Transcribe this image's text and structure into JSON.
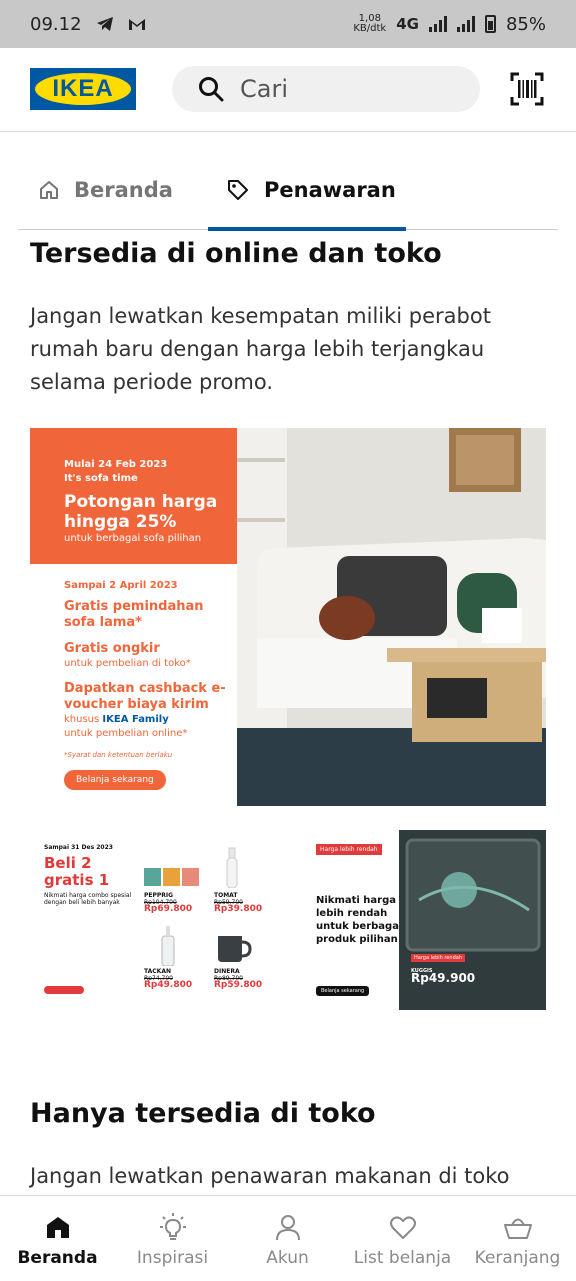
{
  "status_bar": {
    "time": "09.12",
    "net_speed_value": "1,08",
    "net_speed_unit": "KB/dtk",
    "network": "4G",
    "battery": "85%"
  },
  "header": {
    "logo_text": "IKEA",
    "search_placeholder": "Cari"
  },
  "tabs": [
    {
      "label": "Beranda"
    },
    {
      "label": "Penawaran"
    }
  ],
  "section1": {
    "title": "Tersedia di online dan toko",
    "description": "Jangan lewatkan kesempatan miliki perabot rumah baru dengan harga lebih terjangkau selama periode promo."
  },
  "promo": {
    "start": "Mulai 24 Feb 2023",
    "tagline": "It's sofa time",
    "headline": "Potongan harga hingga 25%",
    "subline": "untuk berbagai sofa pilihan",
    "until": "Sampai 2 April 2023",
    "offer1": "Gratis pemindahan sofa lama*",
    "offer2_title": "Gratis ongkir",
    "offer2_sub": "untuk pembelian di toko*",
    "offer3_title": "Dapatkan cashback e-voucher biaya kirim",
    "offer3_pre": "khusus",
    "offer3_brand": "IKEA Family",
    "offer3_post": "untuk pembelian online*",
    "terms": "*Syarat dan ketentuan berlaku",
    "button": "Belanja sekarang"
  },
  "cards": {
    "card1": {
      "date": "Sampai 31 Des 2023",
      "title": "Beli 2 gratis 1",
      "note": "Nikmati harga combo spesial dengan beli lebih banyak"
    },
    "products": [
      {
        "name": "PEPPRIG",
        "old": "Rp104.700",
        "price": "Rp69.800"
      },
      {
        "name": "TOMAT",
        "old": "Rp59.700",
        "price": "Rp39.800"
      },
      {
        "name": "TACKAN",
        "old": "Rp74.700",
        "price": "Rp49.800"
      },
      {
        "name": "DINERA",
        "old": "Rp89.700",
        "price": "Rp59.800"
      }
    ],
    "card3": {
      "tag": "Harga lebih rendah",
      "text": "Nikmati harga lebih rendah untuk berbagai produk pilihan",
      "button": "Belanja sekarang"
    },
    "card4": {
      "badge": "Harga lebih rendah",
      "name": "KUGGIS",
      "price": "Rp49.900"
    }
  },
  "section2": {
    "title": "Hanya tersedia di toko",
    "description": "Jangan lewatkan penawaran makanan di toko IKEA."
  },
  "bottom_nav": [
    {
      "label": "Beranda"
    },
    {
      "label": "Inspirasi"
    },
    {
      "label": "Akun"
    },
    {
      "label": "List belanja"
    },
    {
      "label": "Keranjang"
    }
  ],
  "colors": {
    "ikea_blue": "#0058a3",
    "ikea_yellow": "#ffdb00",
    "promo_orange": "#f0663a",
    "sale_red": "#e23a3a"
  }
}
